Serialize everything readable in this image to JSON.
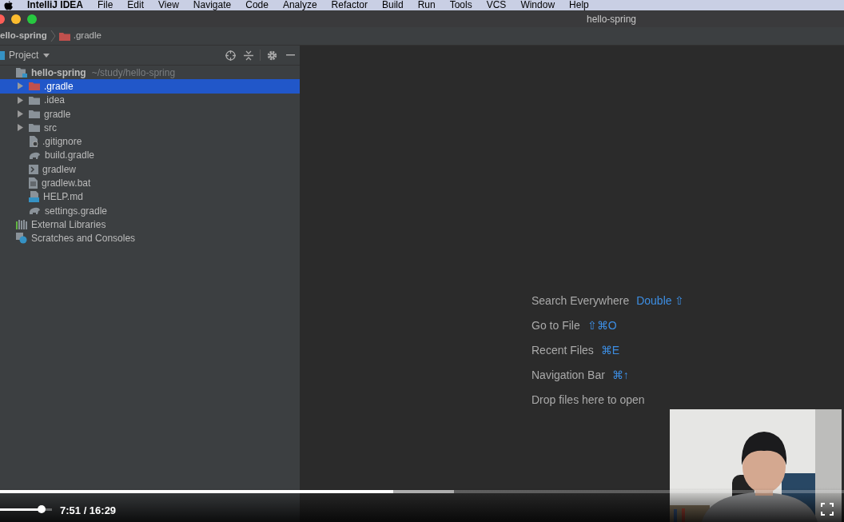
{
  "menu_bar": {
    "items": [
      "IntelliJ IDEA",
      "File",
      "Edit",
      "View",
      "Navigate",
      "Code",
      "Analyze",
      "Refactor",
      "Build",
      "Run",
      "Tools",
      "VCS",
      "Window",
      "Help"
    ]
  },
  "window": {
    "title": "hello-spring"
  },
  "breadcrumb": [
    "ello-spring",
    ".gradle"
  ],
  "project_panel": {
    "title": "Project",
    "tree": [
      {
        "label": "hello-spring",
        "path": "~/study/hello-spring",
        "kind": "module",
        "selected": false,
        "children": [
          {
            "label": ".gradle",
            "kind": "folder-excluded",
            "expanded": false,
            "selected": true
          },
          {
            "label": ".idea",
            "kind": "folder",
            "expanded": false,
            "selected": false
          },
          {
            "label": "gradle",
            "kind": "folder",
            "expanded": false,
            "selected": false
          },
          {
            "label": "src",
            "kind": "folder",
            "expanded": false,
            "selected": false
          },
          {
            "label": ".gitignore",
            "kind": "ignore",
            "selected": false
          },
          {
            "label": "build.gradle",
            "kind": "gradle",
            "selected": false
          },
          {
            "label": "gradlew",
            "kind": "script",
            "selected": false
          },
          {
            "label": "gradlew.bat",
            "kind": "text",
            "selected": false
          },
          {
            "label": "HELP.md",
            "kind": "markdown",
            "selected": false
          },
          {
            "label": "settings.gradle",
            "kind": "gradle",
            "selected": false
          }
        ]
      },
      {
        "label": "External Libraries",
        "kind": "libraries",
        "selected": false
      },
      {
        "label": "Scratches and Consoles",
        "kind": "scratches",
        "selected": false
      }
    ]
  },
  "editor_hints": [
    {
      "label": "Search Everywhere",
      "shortcut": "Double ⇧"
    },
    {
      "label": "Go to File",
      "shortcut": "⇧⌘O"
    },
    {
      "label": "Recent Files",
      "shortcut": "⌘E"
    },
    {
      "label": "Navigation Bar",
      "shortcut": "⌘↑"
    },
    {
      "label": "Drop files here to open"
    }
  ],
  "video_player": {
    "progress": {
      "level": 0.466
    },
    "buffer": {
      "level": 0.538
    },
    "volume": {
      "level": 0.8
    },
    "time": "7:51 / 16:29"
  }
}
